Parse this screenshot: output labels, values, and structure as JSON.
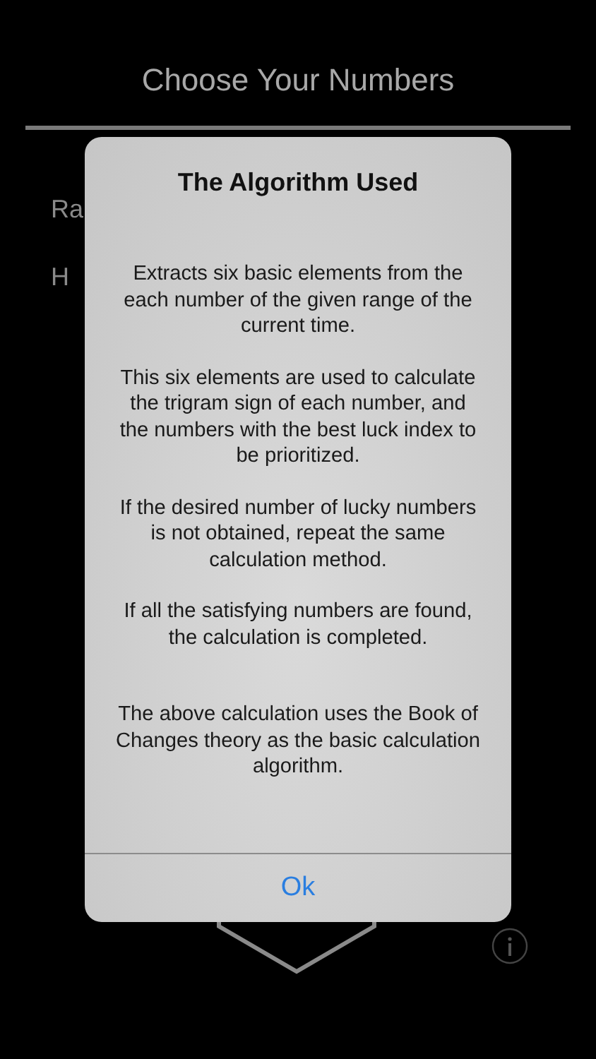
{
  "header": {
    "title": "Choose Your Numbers"
  },
  "background_rows": [
    "Ra",
    "H"
  ],
  "dialog": {
    "title": "The Algorithm Used",
    "paragraphs": [
      "Extracts six basic elements from the each number of the given range of the current time.",
      "This six elements are used to calculate the trigram sign of each number, and the numbers with the best luck index to be prioritized.",
      "If the desired number of lucky numbers is not obtained, repeat the same calculation method.",
      "If all the satisfying numbers are found, the calculation is completed.",
      "The above calculation uses the Book of Changes theory as the basic calculation algorithm."
    ],
    "button": "Ok"
  }
}
